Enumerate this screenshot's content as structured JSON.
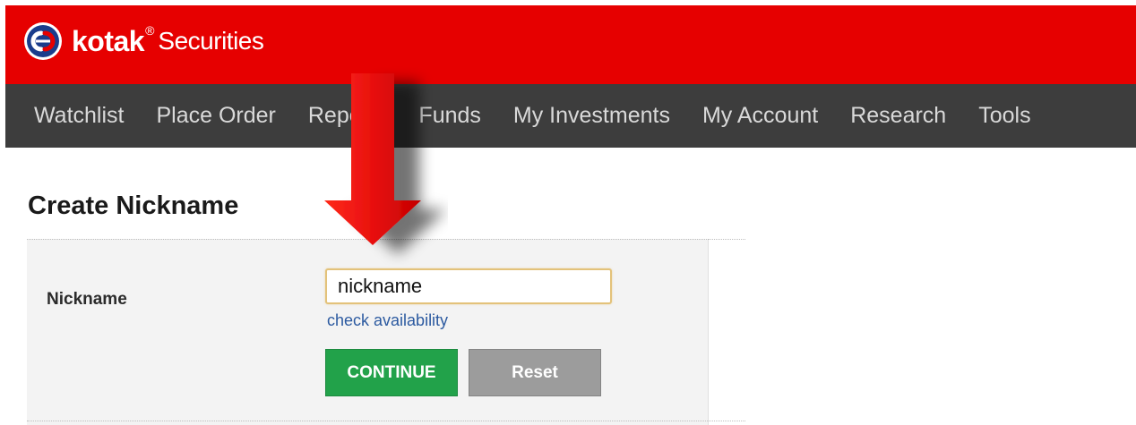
{
  "header": {
    "brand_name": "kotak",
    "brand_reg": "®",
    "brand_suffix": "Securities",
    "brand_color": "#e60000"
  },
  "nav": {
    "background": "#3d3d3d",
    "items": [
      {
        "label": "Watchlist"
      },
      {
        "label": "Place Order"
      },
      {
        "label": "Reports"
      },
      {
        "label": "Funds"
      },
      {
        "label": "My Investments"
      },
      {
        "label": "My Account"
      },
      {
        "label": "Research"
      },
      {
        "label": "Tools"
      }
    ]
  },
  "main": {
    "title": "Create Nickname",
    "form": {
      "nickname_label": "Nickname",
      "nickname_value": "nickname",
      "check_link": "check availability",
      "continue_label": "CONTINUE",
      "reset_label": "Reset"
    }
  },
  "annotation": {
    "icon": "down-arrow-icon",
    "color": "#e8100f"
  }
}
